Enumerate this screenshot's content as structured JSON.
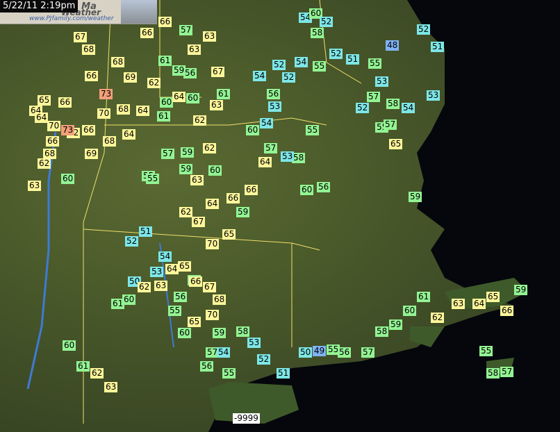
{
  "timestamp": "5/22/11 2:19pm",
  "banner": {
    "title_line1": "rd, Ma",
    "title_line2": "Weather",
    "url": "www.PJfamily.com/weather"
  },
  "missing_value": "-9999",
  "temperatures": [
    "54",
    "60",
    "52",
    "58",
    "52",
    "51",
    "66",
    "57",
    "63",
    "66",
    "67",
    "68",
    "63",
    "68",
    "66",
    "69",
    "61",
    "56",
    "59",
    "67",
    "62",
    "73",
    "70",
    "68",
    "64",
    "65",
    "66",
    "64",
    "70",
    "66",
    "62",
    "66",
    "69",
    "68",
    "68",
    "64",
    "60",
    "64",
    "60",
    "63",
    "61",
    "62",
    "73",
    "64",
    "61",
    "62",
    "59",
    "54",
    "56",
    "53",
    "52",
    "52",
    "54",
    "55",
    "52",
    "51",
    "55",
    "48",
    "53",
    "53",
    "57",
    "58",
    "65",
    "63",
    "60",
    "55",
    "59",
    "62",
    "63",
    "64",
    "58",
    "55",
    "66",
    "54",
    "60",
    "57",
    "60",
    "56",
    "53",
    "52",
    "55",
    "57",
    "54",
    "59",
    "55",
    "57",
    "60",
    "62",
    "64",
    "67",
    "70",
    "65",
    "66",
    "59",
    "58",
    "56",
    "55",
    "54",
    "53",
    "52",
    "51",
    "50",
    "60",
    "61",
    "62",
    "63",
    "64",
    "65",
    "66",
    "67",
    "68",
    "70",
    "65",
    "60",
    "59",
    "58",
    "57",
    "56",
    "55",
    "54",
    "53",
    "52",
    "51",
    "50",
    "49",
    "55",
    "56",
    "57",
    "58",
    "59",
    "60",
    "61",
    "62",
    "63",
    "64",
    "65",
    "66",
    "55",
    "57",
    "58",
    "59",
    "60",
    "61",
    "62",
    "63"
  ]
}
